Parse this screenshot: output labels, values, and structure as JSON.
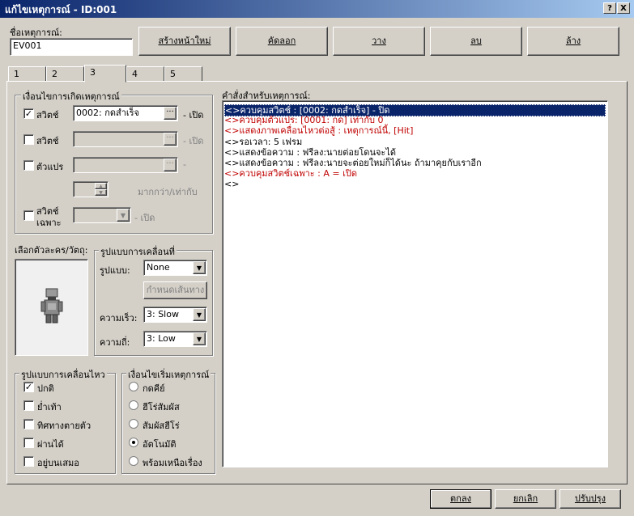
{
  "window": {
    "title": "แก้ไขเหตุการณ์ - ID:001",
    "help": "?",
    "close": "X"
  },
  "event_name": {
    "label": "ชื่อเหตุการณ์:",
    "value": "EV001"
  },
  "toolbar": {
    "new": "สร้างหน้าใหม่",
    "copy": "คัดลอก",
    "paste": "วาง",
    "delete": "ลบ",
    "clear": "ล้าง"
  },
  "tabs": [
    "1",
    "2",
    "3",
    "4",
    "5"
  ],
  "conditions": {
    "legend": "เงื่อนไขการเกิดเหตุการณ์",
    "switch1": {
      "label": "สวิตช์",
      "checked": true,
      "value": "0002: กดสำเร็จ",
      "suffix": "- เปิด"
    },
    "switch2": {
      "label": "สวิตช์",
      "checked": false,
      "value": "",
      "suffix": "- เปิด"
    },
    "variable": {
      "label": "ตัวแปร",
      "checked": false,
      "value": "",
      "suffix": "-",
      "compare": "มากกว่า/เท่ากับ"
    },
    "self_switch": {
      "label_line1": "สวิตช์",
      "label_line2": "เฉพาะ",
      "checked": false,
      "suffix": "- เปิด"
    }
  },
  "graphic": {
    "label": "เลือกตัวละคร/วัตถุ:"
  },
  "movement": {
    "legend": "รูปแบบการเคลื่อนที่",
    "type_label": "รูปแบบ:",
    "type_value": "None",
    "route_button": "กำหนดเส้นทาง",
    "speed_label": "ความเร็ว:",
    "speed_value": "3: Slow",
    "freq_label": "ความถี่:",
    "freq_value": "3: Low"
  },
  "options": {
    "legend": "รูปแบบการเคลื่อนไหว",
    "items": [
      {
        "label": "ปกติ",
        "checked": true
      },
      {
        "label": "ย่ำเท้า",
        "checked": false
      },
      {
        "label": "ทิศทางตายตัว",
        "checked": false
      },
      {
        "label": "ผ่านได้",
        "checked": false
      },
      {
        "label": "อยู่บนเสมอ",
        "checked": false
      }
    ]
  },
  "trigger": {
    "legend": "เงื่อนไขเริ่มเหตุการณ์",
    "items": [
      {
        "label": "กดคีย์",
        "selected": false
      },
      {
        "label": "ฮีโร่สัมผัส",
        "selected": false
      },
      {
        "label": "สัมผัสฮีโร่",
        "selected": false
      },
      {
        "label": "อัตโนมัติ",
        "selected": true
      },
      {
        "label": "พร้อมเหนือเรื่อง",
        "selected": false
      }
    ]
  },
  "commands": {
    "label": "คำสั่งสำหรับเหตุการณ์:",
    "lines": [
      {
        "text": "<>ควบคุมสวิตช์ : [0002: กดสำเร็จ] - ปิด",
        "color": "#000000",
        "selected": true
      },
      {
        "text": "<>ควบคุมตัวแปร: [0001: กด] เท่ากับ 0",
        "color": "#c00000",
        "selected": false
      },
      {
        "text": "<>แสดงภาพเคลื่อนไหวต่อสู้ : เหตุการณ์นี้, [Hit]",
        "color": "#c00000",
        "selected": false
      },
      {
        "text": "<>รอเวลา: 5 เฟรม",
        "color": "#000000",
        "selected": false
      },
      {
        "text": "<>แสดงข้อความ : ฟรีลง:นายต่อยโดนจะได้",
        "color": "#000000",
        "selected": false
      },
      {
        "text": "<>แสดงข้อความ : ฟรีลง:นายจะต่อยใหม่ก็ได้นะ ถ้ามาคุยกับเราอีก",
        "color": "#000000",
        "selected": false
      },
      {
        "text": "<>ควบคุมสวิตช์เฉพาะ : A = เปิด",
        "color": "#c00000",
        "selected": false
      },
      {
        "text": "<>",
        "color": "#000000",
        "selected": false
      }
    ]
  },
  "footer": {
    "ok": "ตกลง",
    "cancel": "ยกเลิก",
    "apply": "ปรับปรุง"
  }
}
